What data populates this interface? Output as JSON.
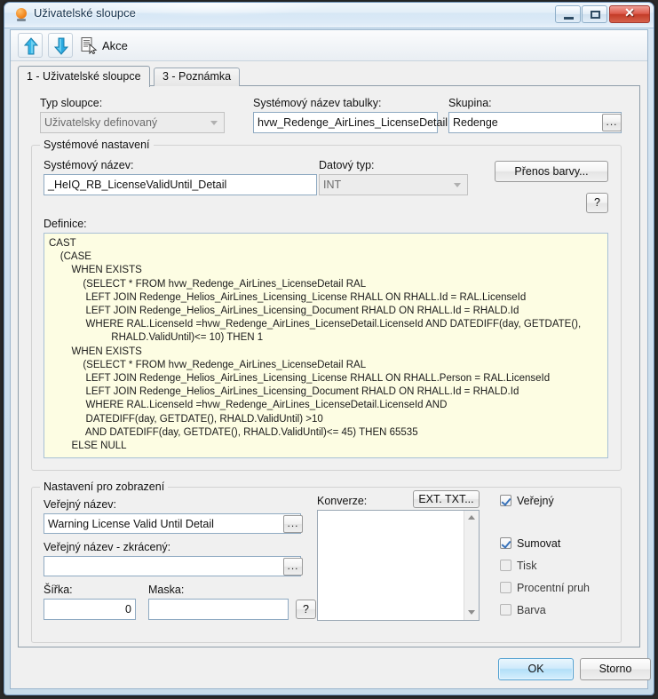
{
  "window": {
    "title": "Uživatelské sloupce",
    "icon": "user-column-icon",
    "buttons": {
      "minimize": "–",
      "maximize": "❐",
      "close": "✕"
    }
  },
  "toolbar": {
    "move_up": "move-up-arrow",
    "move_down": "move-down-arrow",
    "action_icon": "document-action-icon",
    "action_label": "Akce"
  },
  "tabs": [
    {
      "label": "1 - Uživatelské sloupce",
      "active": true
    },
    {
      "label": "3 - Poznámka",
      "active": false
    }
  ],
  "top_fields": {
    "column_type_label": "Typ sloupce:",
    "column_type_value": "Uživatelsky definovaný",
    "table_system_name_label": "Systémový název tabulky:",
    "table_system_name_value": "hvw_Redenge_AirLines_LicenseDetail",
    "group_label": "Skupina:",
    "group_value": "Redenge",
    "group_browse": "..."
  },
  "system_settings": {
    "title": "Systémové nastavení",
    "system_name_label": "Systémový název:",
    "system_name_value": "_HeIQ_RB_LicenseValidUntil_Detail",
    "data_type_label": "Datový typ:",
    "data_type_value": "INT",
    "color_transfer_button": "Přenos barvy...",
    "help_button": "?",
    "definition_label": "Definice:",
    "definition_value": "CAST\n    (CASE\n        WHEN EXISTS\n            (SELECT * FROM hvw_Redenge_AirLines_LicenseDetail RAL\n             LEFT JOIN Redenge_Helios_AirLines_Licensing_License RHALL ON RHALL.Id = RAL.LicenseId\n             LEFT JOIN Redenge_Helios_AirLines_Licensing_Document RHALD ON RHALL.Id = RHALD.Id\n             WHERE RAL.LicenseId =hvw_Redenge_AirLines_LicenseDetail.LicenseId AND DATEDIFF(day, GETDATE(),\n                      RHALD.ValidUntil)<= 10) THEN 1\n        WHEN EXISTS\n            (SELECT * FROM hvw_Redenge_AirLines_LicenseDetail RAL\n             LEFT JOIN Redenge_Helios_AirLines_Licensing_License RHALL ON RHALL.Person = RAL.LicenseId\n             LEFT JOIN Redenge_Helios_AirLines_Licensing_Document RHALD ON RHALL.Id = RHALD.Id\n             WHERE RAL.LicenseId =hvw_Redenge_AirLines_LicenseDetail.LicenseId AND\n             DATEDIFF(day, GETDATE(), RHALD.ValidUntil) >10\n             AND DATEDIFF(day, GETDATE(), RHALD.ValidUntil)<= 45) THEN 65535\n        ELSE NULL"
  },
  "display_settings": {
    "title": "Nastavení pro zobrazení",
    "public_name_label": "Veřejný název:",
    "public_name_value": "Warning License Valid Until Detail",
    "public_name_browse": "...",
    "short_name_label": "Veřejný název - zkrácený:",
    "short_name_value": "",
    "short_name_browse": "...",
    "width_label": "Šířka:",
    "width_value": "0",
    "mask_label": "Maska:",
    "mask_value": "",
    "mask_help": "?",
    "conversion_label": "Konverze:",
    "conversion_button": "EXT. TXT...",
    "conversion_value": "",
    "checkboxes": [
      {
        "label": "Veřejný",
        "checked": true,
        "enabled": true
      },
      {
        "label": "Sumovat",
        "checked": true,
        "enabled": true
      },
      {
        "label": "Tisk",
        "checked": false,
        "enabled": false
      },
      {
        "label": "Procentní pruh",
        "checked": false,
        "enabled": false
      },
      {
        "label": "Barva",
        "checked": false,
        "enabled": false
      }
    ]
  },
  "footer": {
    "ok_label": "OK",
    "cancel_label": "Storno"
  },
  "colors": {
    "accent": "#4f9fd0",
    "memo_bg": "#fdfde3",
    "window_bg": "#f0f0f0",
    "close_red": "#c33b27"
  }
}
